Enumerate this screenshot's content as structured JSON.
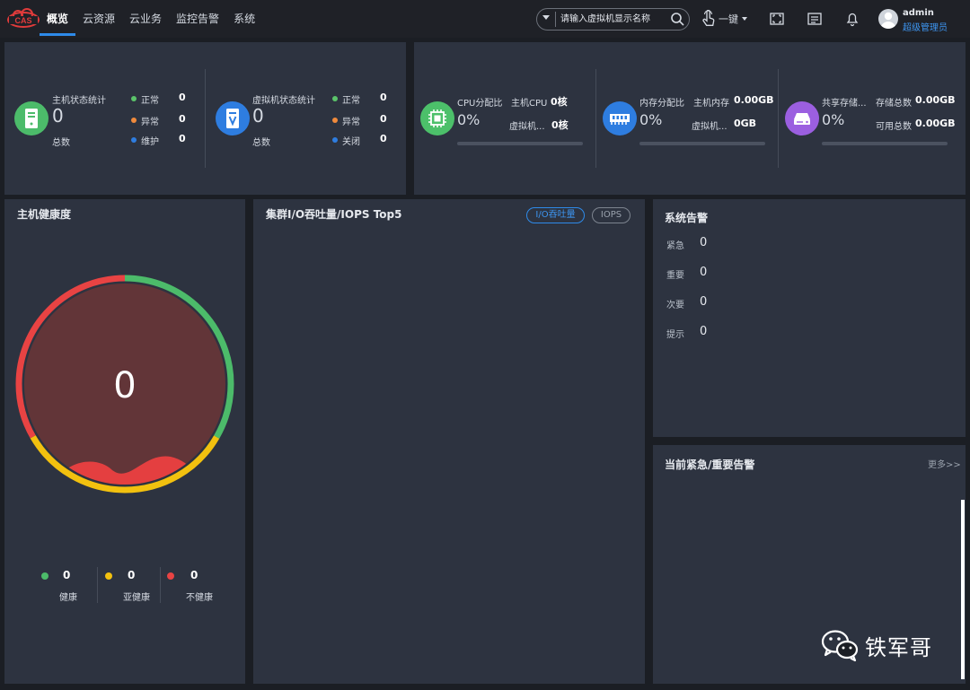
{
  "header": {
    "logo_text": "CAS",
    "nav": [
      {
        "label": "概览",
        "active": true
      },
      {
        "label": "云资源"
      },
      {
        "label": "云业务"
      },
      {
        "label": "监控告警"
      },
      {
        "label": "系统"
      }
    ],
    "search_placeholder": "请输入虚拟机显示名称",
    "one_key_label": "一键",
    "icons": [
      "fullscreen-icon",
      "list-icon",
      "bell-icon"
    ],
    "user": {
      "name": "admin",
      "role": "超级管理员"
    }
  },
  "host_status": {
    "title": "主机状态统计",
    "total": "0",
    "total_label": "总数",
    "legend": [
      {
        "label": "正常",
        "value": "0",
        "color": "#5bc46a"
      },
      {
        "label": "异常",
        "value": "0",
        "color": "#f08a3c"
      },
      {
        "label": "维护",
        "value": "0",
        "color": "#2e7de0"
      }
    ]
  },
  "vm_status": {
    "title": "虚拟机状态统计",
    "total": "0",
    "total_label": "总数",
    "legend": [
      {
        "label": "正常",
        "value": "0",
        "color": "#5bc46a"
      },
      {
        "label": "异常",
        "value": "0",
        "color": "#f08a3c"
      },
      {
        "label": "关闭",
        "value": "0",
        "color": "#2e7de0"
      }
    ]
  },
  "resources": [
    {
      "title": "CPU分配比",
      "percent": "0%",
      "fill": 0,
      "color": "#4cc06a",
      "rows": [
        {
          "label": "主机CPU",
          "value": "0核"
        },
        {
          "label": "虚拟机...",
          "value": "0核"
        }
      ]
    },
    {
      "title": "内存分配比",
      "percent": "0%",
      "fill": 0,
      "color": "#2e7de0",
      "rows": [
        {
          "label": "主机内存",
          "value": "0.00GB"
        },
        {
          "label": "虚拟机...",
          "value": "0GB"
        }
      ]
    },
    {
      "title": "共享存储...",
      "percent": "0%",
      "fill": 0,
      "color": "#9b5fe0",
      "rows": [
        {
          "label": "存储总数",
          "value": "0.00GB"
        },
        {
          "label": "可用总数",
          "value": "0.00GB"
        }
      ]
    }
  ],
  "health": {
    "title": "主机健康度",
    "score": "0",
    "ring_colors": {
      "healthy": "#4cbb6a",
      "subhealthy": "#f2c10f",
      "unhealthy": "#e84343"
    },
    "legend": [
      {
        "label": "健康",
        "value": "0",
        "color": "#4cbb6a"
      },
      {
        "label": "亚健康",
        "value": "0",
        "color": "#f2c10f"
      },
      {
        "label": "不健康",
        "value": "0",
        "color": "#e84343"
      }
    ]
  },
  "io_panel": {
    "title": "集群I/O吞吐量/IOPS Top5",
    "tabs": [
      {
        "label": "I/O吞吐量",
        "active": true
      },
      {
        "label": "IOPS"
      }
    ]
  },
  "alarms": {
    "title": "系统告警",
    "items": [
      {
        "label": "紧急",
        "value": "0"
      },
      {
        "label": "重要",
        "value": "0"
      },
      {
        "label": "次要",
        "value": "0"
      },
      {
        "label": "提示",
        "value": "0"
      }
    ]
  },
  "current_alarms": {
    "title": "当前紧急/重要告警",
    "more_label": "更多>>"
  },
  "watermark": "铁军哥"
}
